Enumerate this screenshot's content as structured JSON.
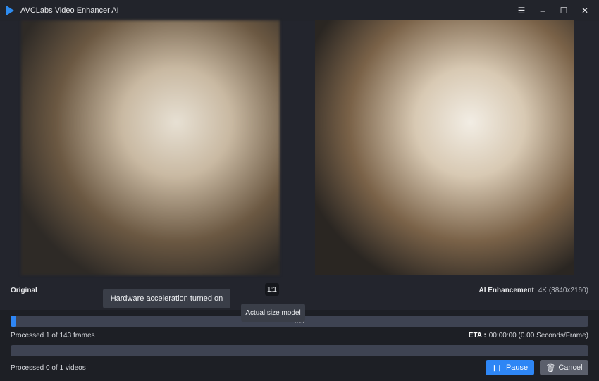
{
  "window": {
    "title": "AVCLabs Video Enhancer AI",
    "controls": [
      "menu-icon",
      "minimize-icon",
      "maximize-icon",
      "close-icon"
    ]
  },
  "preview": {
    "original_label": "Original",
    "enhanced_label": "AI Enhancement",
    "resolution": "4K (3840x2160)",
    "ratio_button": "1:1"
  },
  "tooltips": {
    "hardware": "Hardware acceleration turned on",
    "actual_size": "Actual size model"
  },
  "progress": {
    "frames_percent": 1,
    "frames_percent_text": "0%",
    "frames_text": "Processed 1 of 143 frames",
    "eta_label": "ETA :",
    "eta_value": "00:00:00 (0.00 Seconds/Frame)",
    "videos_percent": 0,
    "videos_text": "Processed 0 of 1 videos"
  },
  "buttons": {
    "pause": "Pause",
    "cancel": "Cancel"
  },
  "colors": {
    "accent": "#2e86f5"
  }
}
